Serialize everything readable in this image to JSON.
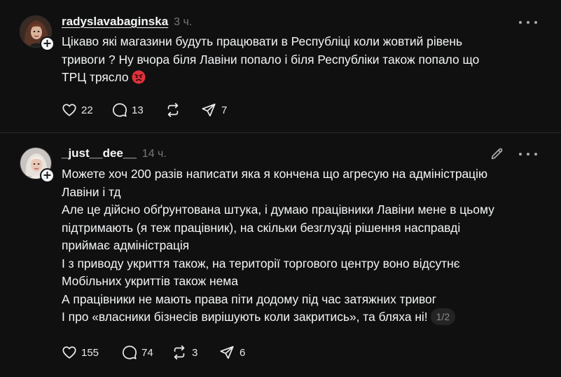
{
  "posts": [
    {
      "username": "radyslavabaginska",
      "time": "3 ч.",
      "lines": [
        "Цікаво які магазини будуть працювати в Республіці коли жовтий рівень",
        "тривоги ? Ну вчора біля Лавіни попало і біля Республіки також попало що",
        "ТРЦ трясло"
      ],
      "emoji": "angry-face-icon",
      "likes": "22",
      "comments": "13",
      "reposts": "",
      "shares": "7"
    },
    {
      "username": "_just__dee__",
      "time": "14 ч.",
      "lines": [
        "Можете хоч 200 разів написати яка я кончена що агресую на адміністрацію",
        "Лавіни і тд",
        "Але це дійсно обґрунтована штука, і думаю працівники Лавіни мене в цьому",
        "підтримають (я теж працівник), на скільки безглузді рішення насправді",
        "приймає адміністрація",
        "І з приводу укриття також, на території торгового центру воно відсутнє",
        "Мобільних укриттів також нема",
        "А працівники не мають права піти додому під час затяжних тривог",
        "І про «власники бізнесів вирішують коли закритись», та бляха ні!"
      ],
      "page_indicator": "1/2",
      "likes": "155",
      "comments": "74",
      "reposts": "3",
      "shares": "6"
    }
  ],
  "colors": {
    "background": "#101010",
    "text": "#f3f5f7",
    "muted": "#777777",
    "divider": "#2b2b2b"
  }
}
